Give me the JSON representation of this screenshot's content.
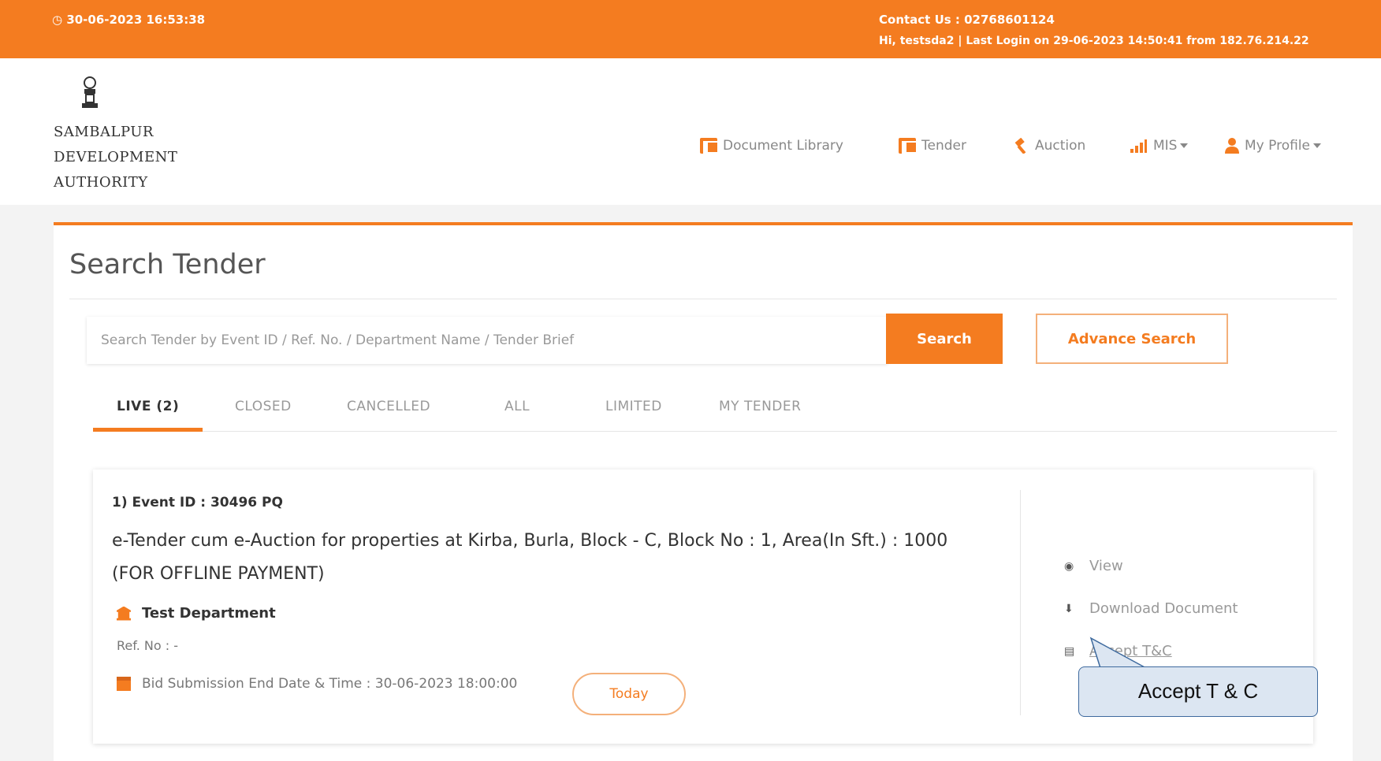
{
  "topbar": {
    "datetime": "30-06-2023 16:53:38",
    "contact": "Contact Us : 02768601124",
    "login_info": "Hi, testsda2 | Last Login on 29-06-2023 14:50:41 from 182.76.214.22"
  },
  "header": {
    "org_line1": "SAMBALPUR",
    "org_line2": "DEVELOPMENT",
    "org_line3": "AUTHORITY",
    "nav": {
      "document_library": "Document Library",
      "tender": "Tender",
      "auction": "Auction",
      "mis": "MIS",
      "profile": "My Profile"
    }
  },
  "search": {
    "title": "Search Tender",
    "placeholder": "Search Tender by Event ID / Ref. No. / Department Name / Tender Brief",
    "search_label": "Search",
    "advance_label": "Advance Search"
  },
  "tabs": {
    "live": "LIVE (2)",
    "closed": "CLOSED",
    "cancelled": "CANCELLED",
    "all": "ALL",
    "limited": "LIMITED",
    "my_tender": "MY TENDER"
  },
  "card": {
    "event_id": "1) Event ID : 30496 PQ",
    "title": "e-Tender cum e-Auction for properties at Kirba, Burla, Block - C, Block No : 1, Area(In Sft.) : 1000 (FOR OFFLINE PAYMENT)",
    "department": "Test Department",
    "ref_no": "Ref. No : -",
    "bid_end": "Bid Submission End Date & Time : 30-06-2023 18:00:00",
    "today_label": "Today",
    "actions": {
      "view": "View",
      "download": "Download Document",
      "accept": "Accept T&C"
    }
  },
  "callout": {
    "text": "Accept T & C"
  },
  "colors": {
    "brand_orange": "#f47c20",
    "callout_fill": "#dce6f2",
    "callout_border": "#3e6a9e"
  }
}
